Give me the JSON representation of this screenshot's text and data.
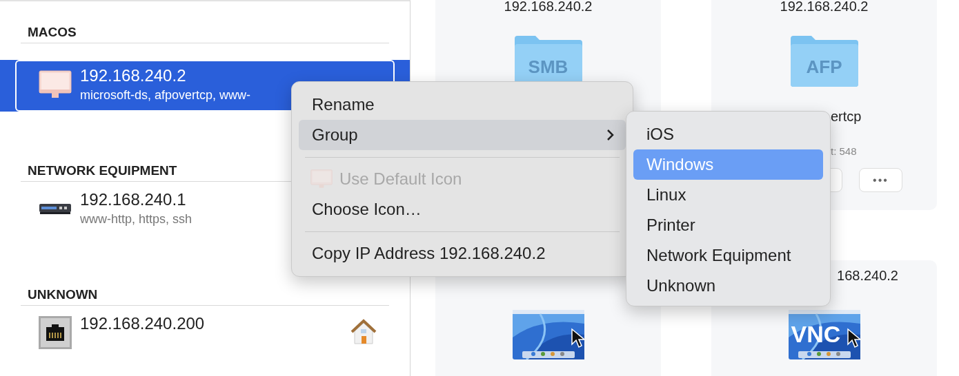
{
  "sidebar": {
    "groups": [
      {
        "title": "MACOS",
        "devices": [
          {
            "ip": "192.168.240.2",
            "services": "microsoft-ds, afpovertcp, www-",
            "kind": "imac",
            "selected": true
          }
        ]
      },
      {
        "title": "NETWORK EQUIPMENT",
        "devices": [
          {
            "ip": "192.168.240.1",
            "services": "www-http, https, ssh",
            "kind": "router",
            "selected": false
          }
        ]
      },
      {
        "title": "UNKNOWN",
        "devices": [
          {
            "ip": "192.168.240.200",
            "kind": "ethernet",
            "selected": false,
            "home": true
          }
        ]
      }
    ]
  },
  "cards": [
    {
      "title": "192.168.240.2",
      "kind": "folder",
      "label": "SMB"
    },
    {
      "title": "192.168.240.2",
      "kind": "folder",
      "label": "AFP",
      "detail": "ertcp",
      "count": "t: 548",
      "more": "•••"
    },
    {
      "kind": "screen"
    },
    {
      "title": "168.240.2",
      "kind": "screen",
      "label": "VNC"
    }
  ],
  "context_menu": {
    "items": [
      {
        "kind": "item",
        "label": "Rename",
        "disabled": false,
        "highlighted": false
      },
      {
        "kind": "submenu",
        "label": "Group",
        "disabled": false,
        "highlighted": true
      },
      {
        "kind": "separator"
      },
      {
        "kind": "icon-item",
        "label": "Use Default Icon",
        "disabled": true,
        "highlighted": false
      },
      {
        "kind": "item",
        "label": "Choose Icon…",
        "disabled": false,
        "highlighted": false
      },
      {
        "kind": "separator"
      },
      {
        "kind": "item",
        "label": "Copy IP Address 192.168.240.2",
        "disabled": false,
        "highlighted": false
      }
    ]
  },
  "submenu": {
    "items": [
      {
        "label": "iOS",
        "selected": false
      },
      {
        "label": "Windows",
        "selected": true
      },
      {
        "label": "Linux",
        "selected": false
      },
      {
        "label": "Printer",
        "selected": false
      },
      {
        "label": "Network Equipment",
        "selected": false
      },
      {
        "label": "Unknown",
        "selected": false
      }
    ]
  }
}
